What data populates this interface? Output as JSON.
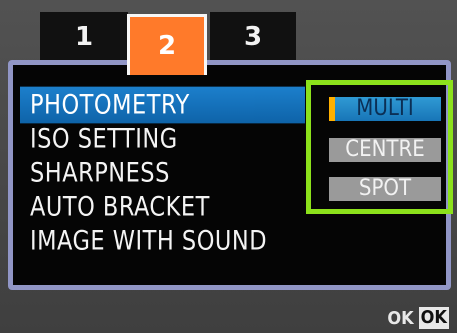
{
  "tabs": [
    {
      "label": "1"
    },
    {
      "label": "2"
    },
    {
      "label": "3"
    }
  ],
  "active_tab": "2",
  "menu": {
    "items": [
      {
        "label": "PHOTOMETRY"
      },
      {
        "label": "ISO SETTING"
      },
      {
        "label": "SHARPNESS"
      },
      {
        "label": "AUTO BRACKET"
      },
      {
        "label": "IMAGE WITH SOUND"
      }
    ],
    "selected": "PHOTOMETRY"
  },
  "photometry_options": {
    "items": [
      {
        "label": "MULTI"
      },
      {
        "label": "CENTRE"
      },
      {
        "label": "SPOT"
      }
    ],
    "selected": "MULTI"
  },
  "footer": {
    "ok_label": "OK",
    "ok_key": "OK"
  },
  "colors": {
    "active_tab": "#ff7a2a",
    "selection_blue": "#1c7fcc",
    "highlight_frame": "#8ce11b",
    "panel_border": "#9196c6",
    "selection_marker": "#ffb000"
  }
}
